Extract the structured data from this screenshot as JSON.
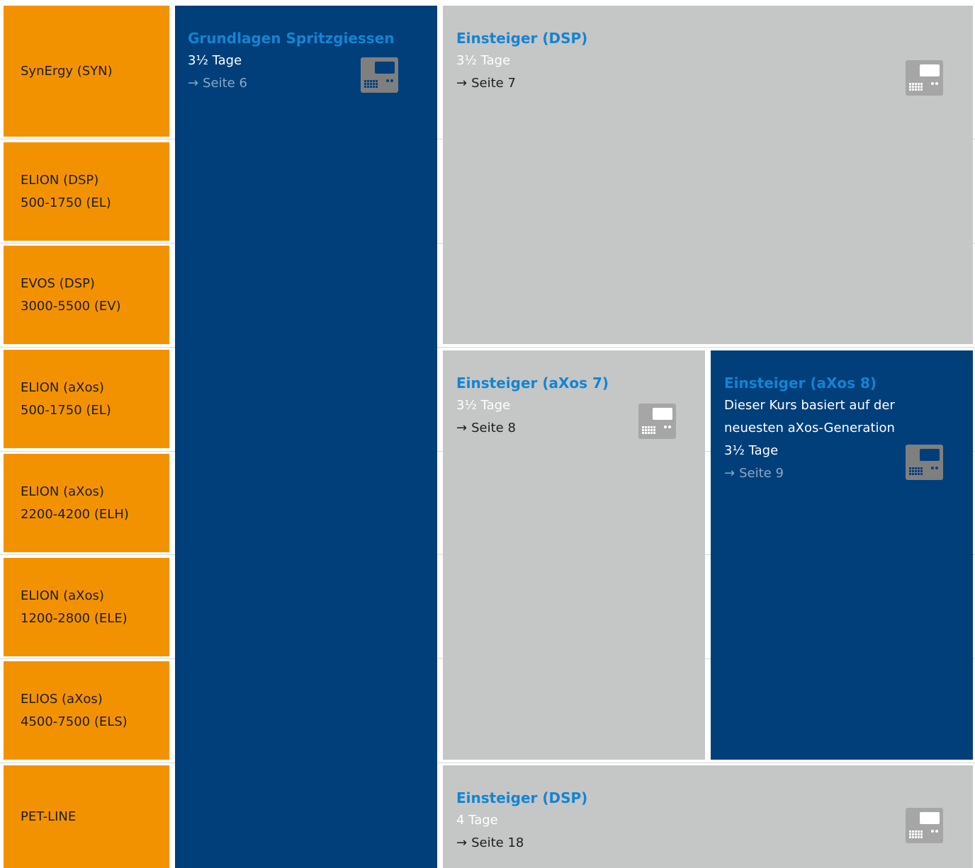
{
  "colors": {
    "machine": "#f39200",
    "dark_course": "#003f7a",
    "light_course": "#c5c6c6",
    "title": "#1484d1"
  },
  "icons": {
    "controller": "control-panel-icon"
  },
  "machines": [
    {
      "line1": "SynErgy (SYN)",
      "line2": ""
    },
    {
      "line1": "ELION (DSP)",
      "line2": "500-1750 (EL)"
    },
    {
      "line1": "EVOS (DSP)",
      "line2": "3000-5500 (EV)"
    },
    {
      "line1": "ELION (aXos)",
      "line2": "500-1750 (EL)"
    },
    {
      "line1": "ELION (aXos)",
      "line2": "2200-4200 (ELH)"
    },
    {
      "line1": "ELION (aXos)",
      "line2": "1200-2800 (ELE)"
    },
    {
      "line1": "ELIOS (aXos)",
      "line2": "4500-7500 (ELS)"
    },
    {
      "line1": "PET-LINE",
      "line2": ""
    }
  ],
  "courses": {
    "grundlagen": {
      "title": "Grundlagen Spritzgiessen",
      "duration": "3½ Tage",
      "page": "Seite 6"
    },
    "einsteiger_dsp": {
      "title": "Einsteiger (DSP)",
      "duration": "3½ Tage",
      "page": "Seite 7"
    },
    "einsteiger_axos7": {
      "title": "Einsteiger (aXos 7)",
      "duration": "3½ Tage",
      "page": "Seite 8"
    },
    "einsteiger_axos8": {
      "title": "Einsteiger (aXos 8)",
      "desc1": "Dieser Kurs basiert auf der",
      "desc2": "neuesten aXos-Generation",
      "duration": "3½ Tage",
      "page": "Seite 9"
    },
    "einsteiger_pet": {
      "title": "Einsteiger (DSP)",
      "duration": "4 Tage",
      "page": "Seite 18"
    }
  },
  "arrow": "→"
}
